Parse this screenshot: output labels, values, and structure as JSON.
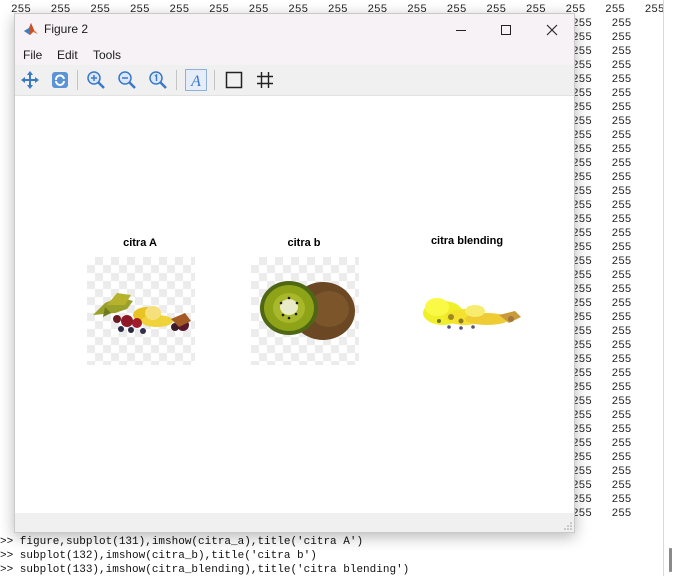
{
  "console": {
    "number_rows": [
      "255   255   255   255   255   255   255   255   255   255   255   255   255   255   255   255   255   255",
      "255   255",
      "255   255",
      "255   255",
      "255   255",
      "255   255",
      "255   255",
      "255   255",
      "255   255",
      "255   255",
      "255   255",
      "255   255",
      "255   255",
      "255   255",
      "255   255",
      "255   255",
      "255   255",
      "255   255",
      "255   255",
      "255   255",
      "255   255",
      "255   255",
      "255   255",
      "255   255",
      "255   255",
      "255   255",
      "255   255",
      "255   255",
      "255   255",
      "255   255",
      "255   255",
      "255   255",
      "255   255",
      "255   255",
      "255   255",
      "255   255",
      "255   255"
    ],
    "commands": [
      ">> figure,subplot(131),imshow(citra_a),title('citra A')",
      ">> subplot(132),imshow(citra_b),title('citra b')",
      ">> subplot(133),imshow(citra_blending),title('citra blending')"
    ]
  },
  "figure_window": {
    "title": "Figure 2",
    "menu": [
      "File",
      "Edit",
      "Tools"
    ],
    "toolbar": [
      "pan-icon",
      "rotate-icon",
      "zoom-in-icon",
      "zoom-out-icon",
      "zoom-reset-icon",
      "text-annotation-icon",
      "axes-box-icon",
      "grid-icon"
    ],
    "subplots": [
      {
        "title": "citra A",
        "image": "fruit-assortment"
      },
      {
        "title": "citra b",
        "image": "kiwi"
      },
      {
        "title": "citra blending",
        "image": "blended-fruit"
      }
    ]
  },
  "colors": {
    "titlebar_bg": "#f7f2f5",
    "toolbar_bg": "#f0f0f0",
    "icon_blue": "#3c78c8"
  }
}
